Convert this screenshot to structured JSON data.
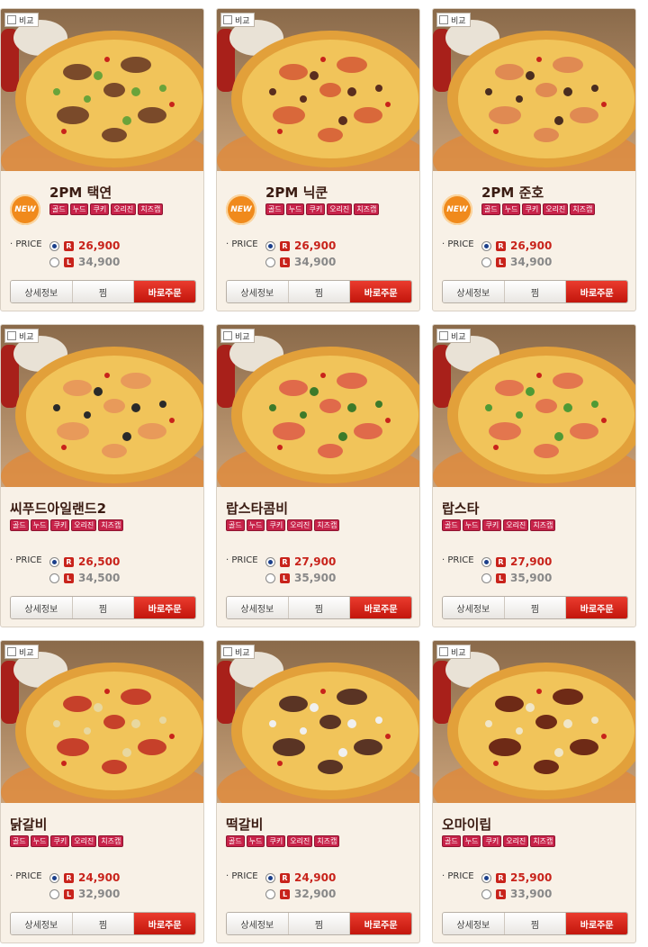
{
  "labels": {
    "compare": "비교",
    "price": "· PRICE",
    "new_badge": "NEW",
    "size_r": "R",
    "size_l": "L",
    "detail": "상세정보",
    "wish": "찜",
    "order": "바로주문"
  },
  "crusts": [
    "골드",
    "누드",
    "쿠키",
    "오리진",
    "치즈캡"
  ],
  "products": [
    {
      "name": "2PM 택연",
      "is_new": true,
      "price_r": "26,900",
      "price_l": "34,900",
      "topping": "#7a4a2a",
      "accent": "#6aa33a"
    },
    {
      "name": "2PM 닉쿤",
      "is_new": true,
      "price_r": "26,900",
      "price_l": "34,900",
      "topping": "#d9683a",
      "accent": "#5a2d1e"
    },
    {
      "name": "2PM 준호",
      "is_new": true,
      "price_r": "26,900",
      "price_l": "34,900",
      "topping": "#e08a52",
      "accent": "#4a2d20"
    },
    {
      "name": "씨푸드아일랜드2",
      "is_new": false,
      "price_r": "26,500",
      "price_l": "34,500",
      "topping": "#e89a5a",
      "accent": "#2a2a2a"
    },
    {
      "name": "랍스타콤비",
      "is_new": false,
      "price_r": "27,900",
      "price_l": "35,900",
      "topping": "#e06a4a",
      "accent": "#3d7a2a"
    },
    {
      "name": "랍스타",
      "is_new": false,
      "price_r": "27,900",
      "price_l": "35,900",
      "topping": "#e3764e",
      "accent": "#4f9a35"
    },
    {
      "name": "닭갈비",
      "is_new": false,
      "price_r": "24,900",
      "price_l": "32,900",
      "topping": "#c6402a",
      "accent": "#e8d8a0"
    },
    {
      "name": "떡갈비",
      "is_new": false,
      "price_r": "24,900",
      "price_l": "32,900",
      "topping": "#5a3424",
      "accent": "#f0f0f0"
    },
    {
      "name": "오마이립",
      "is_new": false,
      "price_r": "25,900",
      "price_l": "33,900",
      "topping": "#6e2a16",
      "accent": "#f0e6c8"
    }
  ]
}
